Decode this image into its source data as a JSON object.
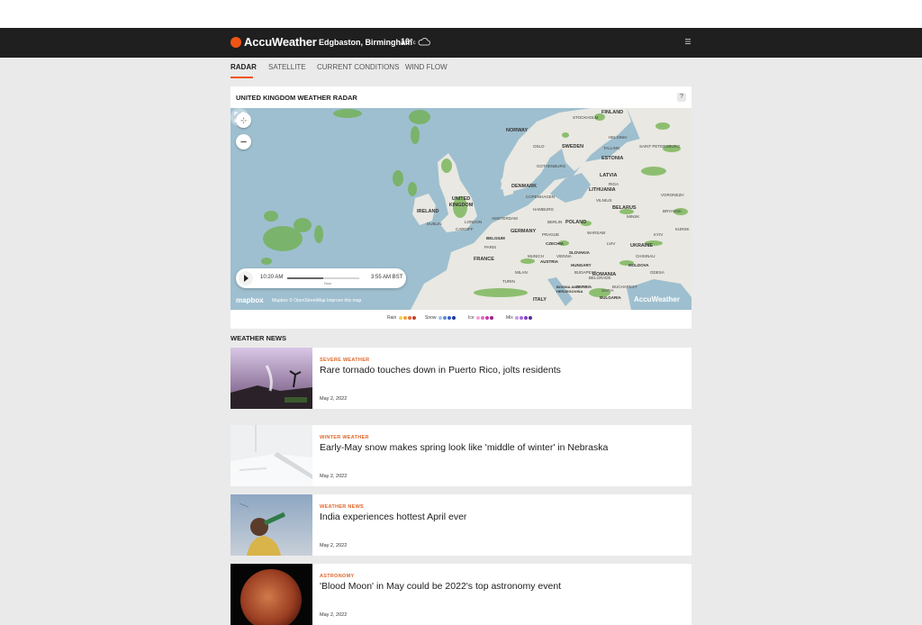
{
  "header": {
    "brand": "AccuWeather",
    "location": "Edgbaston, Birmingham",
    "temperature": "10°",
    "temp_unit": "c",
    "weather_icon": "cloud-icon",
    "menu_icon": "hamburger-icon"
  },
  "tabs": [
    {
      "label": "RADAR",
      "active": true
    },
    {
      "label": "SATELLITE",
      "active": false
    },
    {
      "label": "CURRENT CONDITIONS",
      "active": false
    },
    {
      "label": "WIND FLOW",
      "active": false
    }
  ],
  "radar": {
    "title": "UNITED KINGDOM WEATHER RADAR",
    "help_label": "?",
    "zoom_in": "+",
    "zoom_out": "−",
    "player": {
      "start_time": "10:20 AM",
      "end_time": "3:55 AM BST",
      "now_label": "Now",
      "progress": 0.5
    },
    "attribution_logo": "mapbox",
    "attribution": "Mapbox © OpenStreetMap Improve this map",
    "watermark": "AccuWeather",
    "map_labels": {
      "finland": "FINLAND",
      "norway": "NORWAY",
      "sweden": "SWEDEN",
      "estonia": "ESTONIA",
      "latvia": "LATVIA",
      "lithuania": "LITHUANIA",
      "belarus": "BELARUS",
      "denmark": "DENMARK",
      "uk": "UNITED KINGDOM",
      "ireland": "IRELAND",
      "poland": "POLAND",
      "germany": "GERMANY",
      "ukraine": "UKRAINE",
      "france": "FRANCE",
      "romania": "ROMANIA",
      "italy": "ITALY",
      "czechia": "CZECHIA",
      "austria": "AUSTRIA",
      "moldova": "MOLDOVA",
      "bulgaria": "BULGARIA",
      "serbia": "SERBIA",
      "slovakia": "SLOVAKIA",
      "hungary": "HUNGARY",
      "belgium": "BELGIUM",
      "bosnia": "BOSNIA AND HERZEGOVINA"
    },
    "cities": {
      "oslo": "OSLO",
      "stockholm": "STOCKHOLM",
      "helsinki": "HELSINKI",
      "st_petersburg": "SAINT PETERSBURG",
      "gothenburg": "GOTHENBURG",
      "copenhagen": "COPENHAGEN",
      "hamburg": "HAMBURG",
      "berlin": "BERLIN",
      "warsaw": "WARSAW",
      "vilnius": "VILNIUS",
      "minsk": "MINSK",
      "kyiv": "KYIV",
      "lviv": "LVIV",
      "prague": "PRAGUE",
      "vienna": "VIENNA",
      "munich": "MUNICH",
      "paris": "PARIS",
      "london": "LONDON",
      "dublin": "DUBLIN",
      "cardiff": "CARDIFF",
      "amsterdam": "AMSTERDAM",
      "budapest": "BUDAPEST",
      "bucharest": "BUCHAREST",
      "milan": "MILAN",
      "turin": "TURIN",
      "belgrade": "BELGRADE",
      "sofia": "SOFIA",
      "chisinau": "CHISINAU",
      "odesa": "ODESA",
      "riga": "RIGA",
      "tallinn": "TALLINN",
      "bryansk": "BRYANSK",
      "kursk": "KURSK",
      "voronezh": "VORONEZH"
    }
  },
  "legend": [
    {
      "label": "Rain",
      "colors": [
        "#f3d34a",
        "#f2a13c",
        "#e2703a",
        "#c8402e"
      ]
    },
    {
      "label": "Snow",
      "colors": [
        "#9ec4e8",
        "#5b8fd8",
        "#3a5fc8",
        "#1f3a9a"
      ]
    },
    {
      "label": "Ice",
      "colors": [
        "#f3a4d4",
        "#e06cc0",
        "#c23ca8",
        "#9a1f8a"
      ]
    },
    {
      "label": "Mix",
      "colors": [
        "#c89ae6",
        "#a56ad8",
        "#8040c0",
        "#5c2a9a"
      ]
    }
  ],
  "news": {
    "section_title": "WEATHER NEWS",
    "articles": [
      {
        "category": "SEVERE WEATHER",
        "headline": "Rare tornado touches down in Puerto Rico, jolts residents",
        "date": "May 2, 2022"
      },
      {
        "category": "WINTER WEATHER",
        "headline": "Early-May snow makes spring look like 'middle of winter' in Nebraska",
        "date": "May 2, 2022"
      },
      {
        "category": "WEATHER NEWS",
        "headline": "India experiences hottest April ever",
        "date": "May 2, 2022"
      },
      {
        "category": "ASTRONOMY",
        "headline": "'Blood Moon' in May could be 2022's top astronomy event",
        "date": "May 2, 2022"
      }
    ]
  },
  "colors": {
    "accent": "#f05514",
    "header_bg": "#1f1f1f",
    "page_bg": "#eaeaea",
    "category": "#e0662a"
  }
}
